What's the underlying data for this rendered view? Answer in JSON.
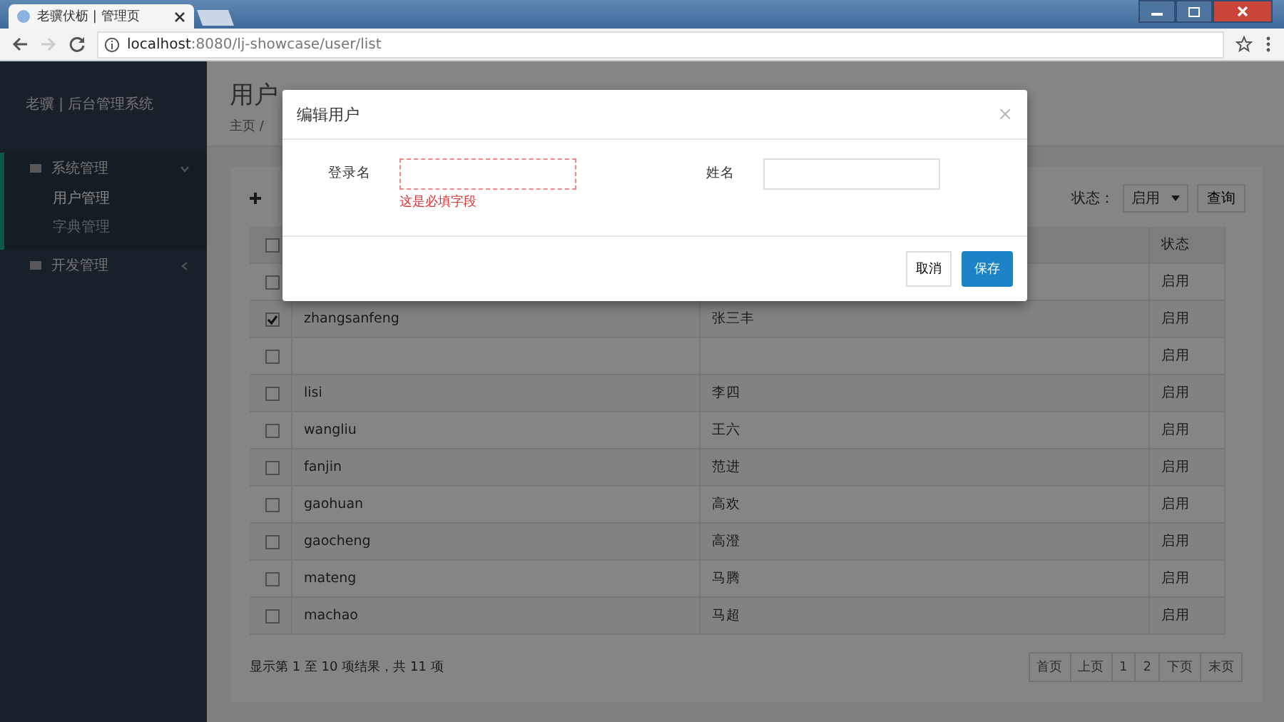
{
  "browser": {
    "tab_title": "老骥伏枥 | 管理页",
    "url_host": "localhost",
    "url_path": ":8080/lj-showcase/user/list"
  },
  "sidebar": {
    "brand": "老骥 | 后台管理系统",
    "items": [
      {
        "label": "系统管理",
        "expanded": true,
        "children": [
          {
            "label": "用户管理",
            "selected": true
          },
          {
            "label": "字典管理",
            "selected": false
          }
        ]
      },
      {
        "label": "开发管理",
        "expanded": false
      }
    ]
  },
  "page": {
    "title": "用户",
    "breadcrumb": "主页 /"
  },
  "filter": {
    "label": "状态：",
    "select": "启用",
    "query_button": "查询"
  },
  "table": {
    "select_all": {
      "checked": false
    },
    "columns": [
      "状态"
    ],
    "rows": [
      {
        "checked": false,
        "status": "启用"
      },
      {
        "checked": true,
        "login": "zhangsanfeng",
        "name": "张三丰",
        "status": "启用"
      },
      {
        "checked": false,
        "status": "启用"
      },
      {
        "checked": false,
        "login": "lisi",
        "name": "李四",
        "status": "启用"
      },
      {
        "checked": false,
        "login": "wangliu",
        "name": "王六",
        "status": "启用"
      },
      {
        "checked": false,
        "login": "fanjin",
        "name": "范进",
        "status": "启用"
      },
      {
        "checked": false,
        "login": "gaohuan",
        "name": "高欢",
        "status": "启用"
      },
      {
        "checked": false,
        "login": "gaocheng",
        "name": "高澄",
        "status": "启用"
      },
      {
        "checked": false,
        "login": "mateng",
        "name": "马腾",
        "status": "启用"
      },
      {
        "checked": false,
        "login": "machao",
        "name": "马超",
        "status": "启用"
      }
    ]
  },
  "summary": "显示第 1 至 10 项结果，共 11 项",
  "pagination": [
    "首页",
    "上页",
    "1",
    "2",
    "下页",
    "末页"
  ],
  "modal": {
    "title": "编辑用户",
    "close": "×",
    "fields": [
      {
        "label": "登录名",
        "error": "这是必填字段",
        "invalid": true
      },
      {
        "label": "姓名",
        "invalid": false
      }
    ],
    "cancel": "取消",
    "save": "保存"
  }
}
